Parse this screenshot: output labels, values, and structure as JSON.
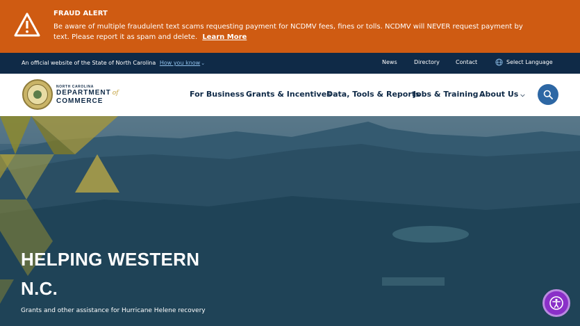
{
  "alert": {
    "title": "FRAUD ALERT",
    "message": "Be aware of multiple fraudulent text scams requesting payment for NCDMV fees, fines or tolls. NCDMV will NEVER request payment by text. Please report it as spam and delete.",
    "learn_more": "Learn More",
    "icon": "warning-icon",
    "color": "#cf5b12"
  },
  "utility": {
    "official_text": "An official website of the State of North Carolina",
    "how_you_know": "How you know",
    "news": "News",
    "directory": "Directory",
    "contact": "Contact",
    "language": "Select Language"
  },
  "brand": {
    "state": "NORTH CAROLINA",
    "line1": "DEPARTMENT",
    "of": "of",
    "line2": "COMMERCE"
  },
  "nav": {
    "items": [
      {
        "label": "For Business"
      },
      {
        "label": "Grants & Incentives"
      },
      {
        "label": "Data, Tools & Reports"
      },
      {
        "label": "Jobs & Training"
      },
      {
        "label": "About Us"
      }
    ]
  },
  "hero": {
    "title": "HELPING WESTERN N.C.",
    "subtitle": "Grants and other assistance for Hurricane Helene recovery"
  },
  "colors": {
    "navy": "#0f2a47",
    "accent_blue": "#2d67a4",
    "gold": "#a99a3a",
    "accessibility_purple": "#8a2fc8"
  }
}
